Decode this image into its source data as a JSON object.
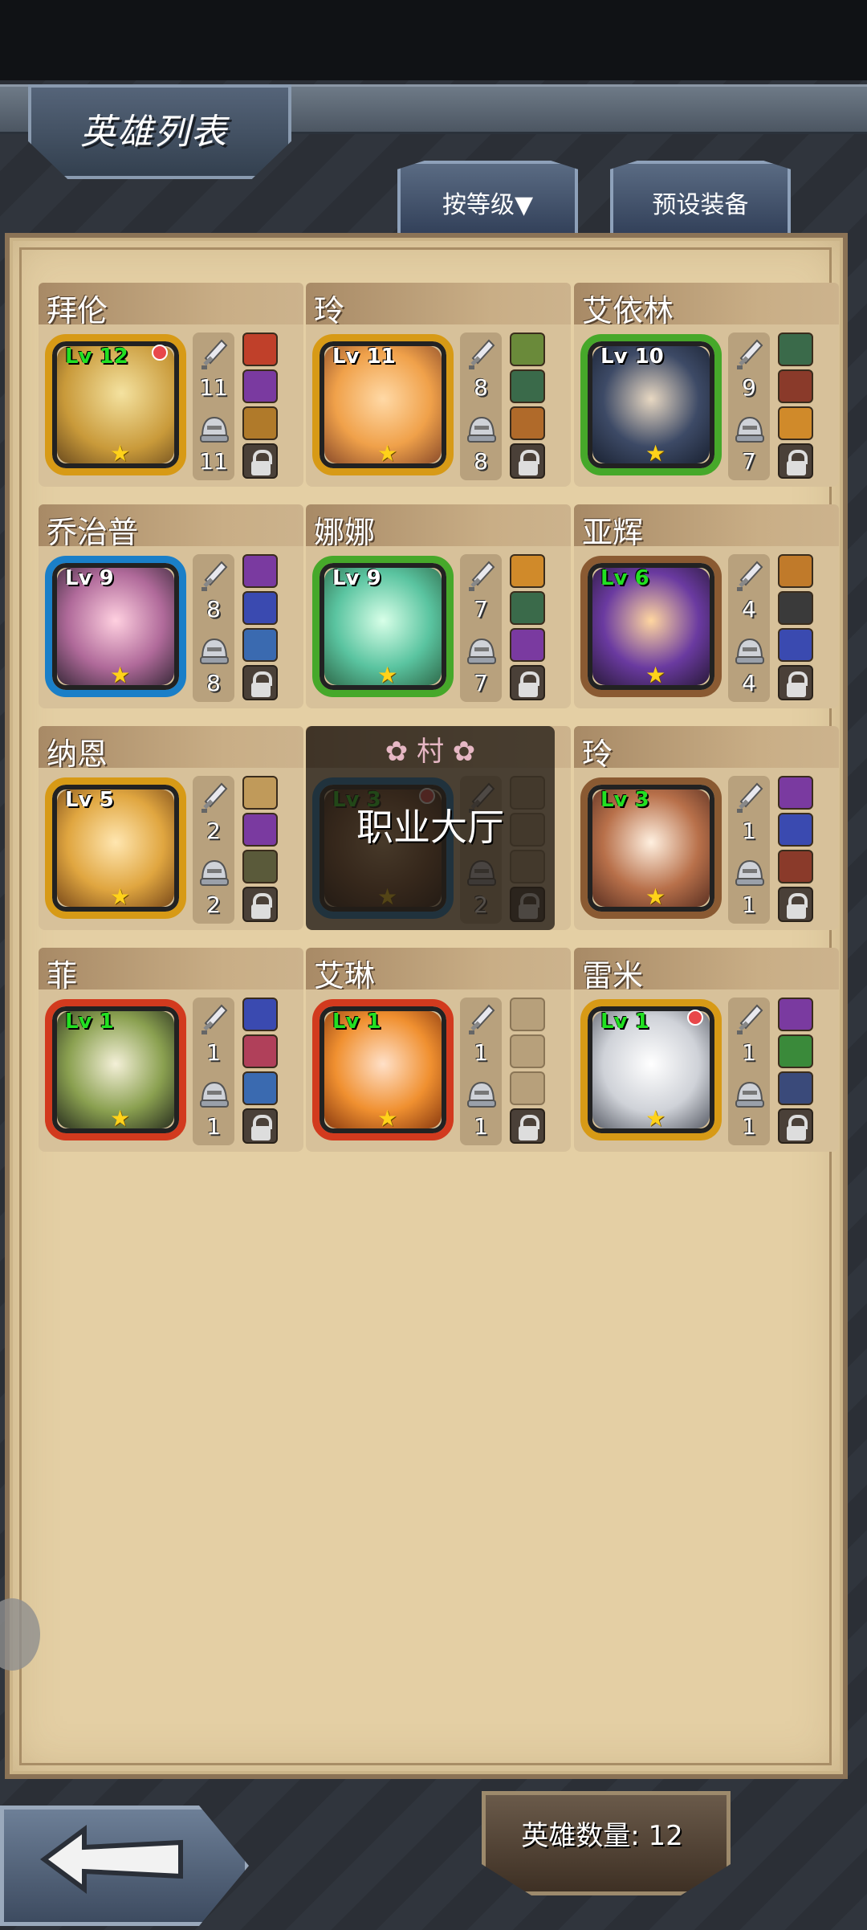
{
  "header": {
    "title": "英雄列表"
  },
  "tabs": {
    "sort": "按等级▼",
    "preset": "预设装备"
  },
  "heroes": [
    {
      "name": "拜伦",
      "level": "Lv 12",
      "atk": "11",
      "def": "11"
    },
    {
      "name": "玲",
      "level": "Lv 11",
      "atk": "8",
      "def": "8"
    },
    {
      "name": "艾依林",
      "level": "Lv 10",
      "atk": "9",
      "def": "7"
    },
    {
      "name": "乔治普",
      "level": "Lv 9",
      "atk": "8",
      "def": "8"
    },
    {
      "name": "娜娜",
      "level": "Lv 9",
      "atk": "7",
      "def": "7"
    },
    {
      "name": "亚辉",
      "level": "Lv 6",
      "atk": "4",
      "def": "4"
    },
    {
      "name": "纳恩",
      "level": "Lv 5",
      "atk": "2",
      "def": "2"
    },
    {
      "name": "",
      "level": "Lv 3",
      "atk": "",
      "def": "2"
    },
    {
      "name": "玲",
      "level": "Lv 3",
      "atk": "1",
      "def": "1"
    },
    {
      "name": "菲",
      "level": "Lv 1",
      "atk": "1",
      "def": "1"
    },
    {
      "name": "艾琳",
      "level": "Lv 1",
      "atk": "1",
      "def": "1"
    },
    {
      "name": "雷米",
      "level": "Lv 1",
      "atk": "1",
      "def": "1"
    }
  ],
  "overlay": {
    "village": "村",
    "label": "职业大厅"
  },
  "footer": {
    "hero_count": "英雄数量: 12"
  },
  "colors": {
    "level_green": "#22e022",
    "level_white": "#ffffff",
    "frame_gold": "#d79a16",
    "frame_blue": "#1a7fc8",
    "frame_green": "#46a82a",
    "frame_brown": "#8a5a32",
    "frame_red": "#d23a1e"
  }
}
